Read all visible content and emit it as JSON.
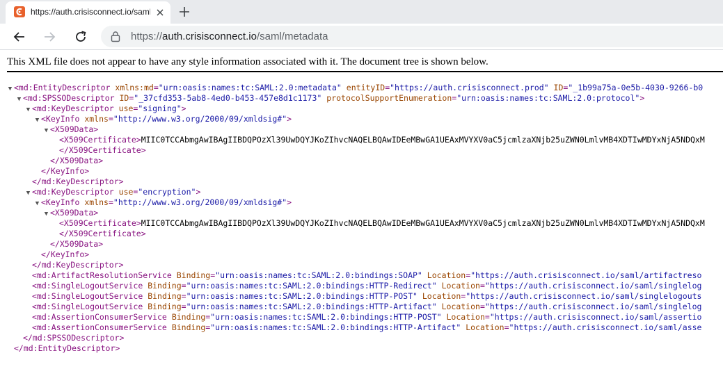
{
  "tab": {
    "title": "https://auth.crisisconnect.io/saml/metadata",
    "favicon": "crisisconnect-favicon-icon",
    "accent": "#e8612c"
  },
  "address_bar": {
    "scheme": "https://",
    "host": "auth.crisisconnect.io",
    "path": "/saml/metadata"
  },
  "page": {
    "notice": "This XML file does not appear to have any style information associated with it. The document tree is shown below."
  },
  "xml": {
    "ed_open_tag": "<md:EntityDescriptor",
    "ed_xmlns_name": "xmlns:md",
    "ed_xmlns_value": "\"urn:oasis:names:tc:SAML:2.0:metadata\"",
    "ed_entity_name": "entityID",
    "ed_entity_value": "\"https://auth.crisisconnect.prod\"",
    "ed_id_name": "ID",
    "ed_id_value": "\"_1b99a75a-0e5b-4030-9266-b0",
    "sp_open_tag": "<md:SPSSODescriptor",
    "sp_id_name": "ID",
    "sp_id_value": "\"_37cfd353-5ab8-4ed0-b453-457e8d1c1173\"",
    "sp_proto_name": "protocolSupportEnumeration",
    "sp_proto_value": "\"urn:oasis:names:tc:SAML:2.0:protocol\"",
    "kd_open_tag": "<md:KeyDescriptor",
    "kd_use_name": "use",
    "kd_signing": "\"signing\"",
    "kd_encryption": "\"encryption\"",
    "ki_open_tag": "<KeyInfo",
    "ki_xmlns_name": "xmlns",
    "ki_xmlns_value": "\"http://www.w3.org/2000/09/xmldsig#\"",
    "x509data_open": "<X509Data>",
    "x509cert_open": "<X509Certificate>",
    "certificate_text": "MIIC0TCCAbmgAwIBAgIIBDQPOzXl39UwDQYJKoZIhvcNAQELBQAwIDEeMBwGA1UEAxMVYXV0aC5jcmlzaXNjb25uZWN0LmlvMB4XDTIwMDYxNjA5NDQxM",
    "x509cert_close": "</X509Certificate>",
    "x509data_close": "</X509Data>",
    "ki_close": "</KeyInfo>",
    "kd_close": "</md:KeyDescriptor>",
    "binding_name": "Binding",
    "location_name": "Location",
    "ars_tag": "<md:ArtifactResolutionService",
    "ars_binding": "\"urn:oasis:names:tc:SAML:2.0:bindings:SOAP\"",
    "ars_location": "\"https://auth.crisisconnect.io/saml/artifactreso",
    "sls_tag": "<md:SingleLogoutService",
    "sls1_binding": "\"urn:oasis:names:tc:SAML:2.0:bindings:HTTP-Redirect\"",
    "sls1_location": "\"https://auth.crisisconnect.io/saml/singlelog",
    "sls2_binding": "\"urn:oasis:names:tc:SAML:2.0:bindings:HTTP-POST\"",
    "sls2_location": "\"https://auth.crisisconnect.io/saml/singlelogouts",
    "sls3_binding": "\"urn:oasis:names:tc:SAML:2.0:bindings:HTTP-Artifact\"",
    "sls3_location": "\"https://auth.crisisconnect.io/saml/singlelog",
    "acs_tag": "<md:AssertionConsumerService",
    "acs1_binding": "\"urn:oasis:names:tc:SAML:2.0:bindings:HTTP-POST\"",
    "acs1_location": "\"https://auth.crisisconnect.io/saml/assertio",
    "acs2_binding": "\"urn:oasis:names:tc:SAML:2.0:bindings:HTTP-Artifact\"",
    "acs2_location": "\"https://auth.crisisconnect.io/saml/asse",
    "sp_close": "</md:SPSSODescriptor>",
    "ed_close": "</md:EntityDescriptor>",
    "gt": ">",
    "self_close": "/>",
    "expanded_icon": "▼"
  }
}
